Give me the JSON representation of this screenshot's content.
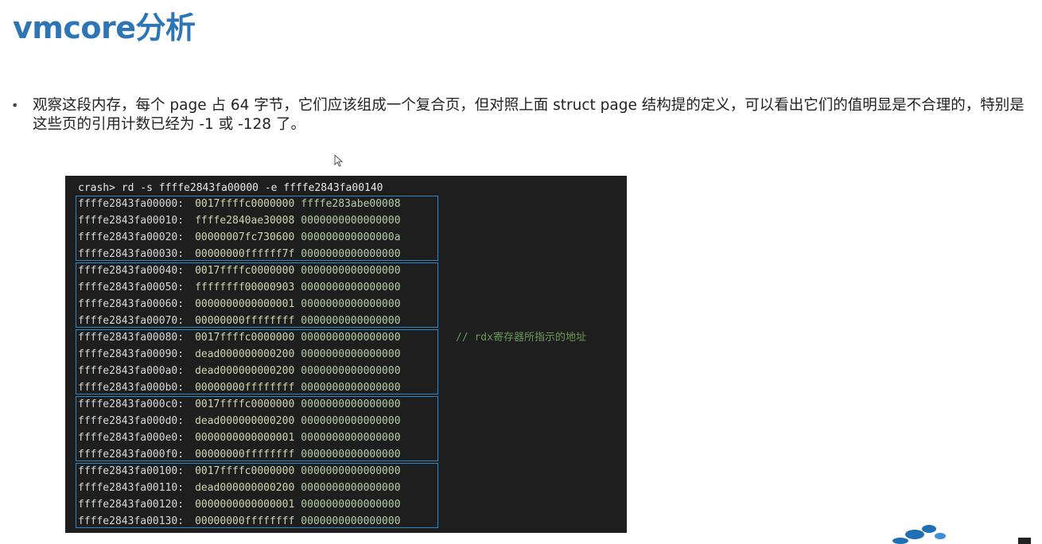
{
  "slide": {
    "title": "vmcore分析",
    "bullet": "观察这段内存，每个 page 占 64 字节，它们应该组成一个复合页，但对照上面 struct page 结构提的定义，可以看出它们的值明显是不合理的，特别是这些页的引用计数已经为 -1 或 -128 了。"
  },
  "terminal": {
    "command": "crash> rd -s ffffe2843fa00000 -e ffffe2843fa00140",
    "comment": "// rdx寄存器所指示的地址",
    "rows": [
      {
        "addr": "ffffe2843fa00000:",
        "v1": "0017ffffc0000000",
        "v2": "ffffe283abe00008"
      },
      {
        "addr": "ffffe2843fa00010:",
        "v1": "ffffe2840ae30008",
        "v2": "0000000000000000"
      },
      {
        "addr": "ffffe2843fa00020:",
        "v1": "00000007fc730600",
        "v2": "000000000000000a"
      },
      {
        "addr": "ffffe2843fa00030:",
        "v1": "00000000ffffff7f",
        "v2": "0000000000000000"
      },
      {
        "addr": "ffffe2843fa00040:",
        "v1": "0017ffffc0000000",
        "v2": "0000000000000000"
      },
      {
        "addr": "ffffe2843fa00050:",
        "v1": "ffffffff00000903",
        "v2": "0000000000000000"
      },
      {
        "addr": "ffffe2843fa00060:",
        "v1": "0000000000000001",
        "v2": "0000000000000000"
      },
      {
        "addr": "ffffe2843fa00070:",
        "v1": "00000000ffffffff",
        "v2": "0000000000000000"
      },
      {
        "addr": "ffffe2843fa00080:",
        "v1": "0017ffffc0000000",
        "v2": "0000000000000000"
      },
      {
        "addr": "ffffe2843fa00090:",
        "v1": "dead000000000200",
        "v2": "0000000000000000"
      },
      {
        "addr": "ffffe2843fa000a0:",
        "v1": "dead000000000200",
        "v2": "0000000000000000"
      },
      {
        "addr": "ffffe2843fa000b0:",
        "v1": "00000000ffffffff",
        "v2": "0000000000000000"
      },
      {
        "addr": "ffffe2843fa000c0:",
        "v1": "0017ffffc0000000",
        "v2": "0000000000000000"
      },
      {
        "addr": "ffffe2843fa000d0:",
        "v1": "dead000000000200",
        "v2": "0000000000000000"
      },
      {
        "addr": "ffffe2843fa000e0:",
        "v1": "0000000000000001",
        "v2": "0000000000000000"
      },
      {
        "addr": "ffffe2843fa000f0:",
        "v1": "00000000ffffffff",
        "v2": "0000000000000000"
      },
      {
        "addr": "ffffe2843fa00100:",
        "v1": "0017ffffc0000000",
        "v2": "0000000000000000"
      },
      {
        "addr": "ffffe2843fa00110:",
        "v1": "dead000000000200",
        "v2": "0000000000000000"
      },
      {
        "addr": "ffffe2843fa00120:",
        "v1": "0000000000000001",
        "v2": "0000000000000000"
      },
      {
        "addr": "ffffe2843fa00130:",
        "v1": "00000000ffffffff",
        "v2": "0000000000000000"
      }
    ]
  },
  "icons": {
    "cursor": "mouse-pointer-icon",
    "logo": "brand-logo-icon"
  },
  "colors": {
    "title": "#2e75b6",
    "terminal_bg": "#1e1e1e",
    "group_border": "#2f87c8",
    "comment": "#6a9955"
  }
}
